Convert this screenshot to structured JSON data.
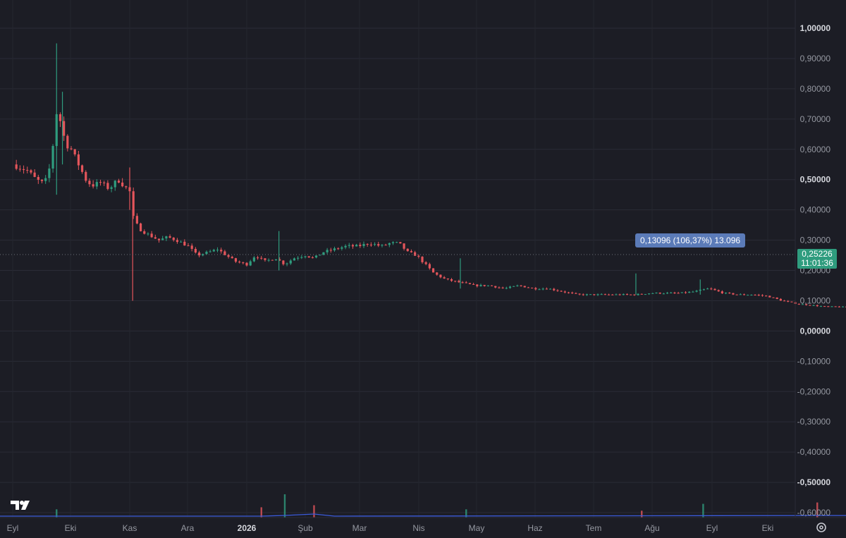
{
  "chart_data": {
    "type": "candlestick",
    "y_axis": {
      "ticks": [
        "1,00000",
        "0,90000",
        "0,80000",
        "0,70000",
        "0,60000",
        "0,50000",
        "0,40000",
        "0,30000",
        "0,20000",
        "0,10000",
        "0,00000",
        "-0,10000",
        "-0,20000",
        "-0,30000",
        "-0,40000",
        "-0,50000",
        "-0,60000"
      ],
      "bold_ticks": [
        "1,00000",
        "0,50000",
        "0,00000",
        "-0,50000"
      ],
      "range": [
        -0.6,
        1.0
      ]
    },
    "x_axis": {
      "ticks": [
        "Eyl",
        "Eki",
        "Kas",
        "Ara",
        "2026",
        "Şub",
        "Mar",
        "Nis",
        "May",
        "Haz",
        "Tem",
        "Ağu",
        "Eyl",
        "Eki"
      ],
      "bold_ticks": [
        "2026"
      ]
    },
    "last_price": "0,25226",
    "countdown": "11:01:36",
    "measurement": "0,13096 (106,37%) 13.096",
    "price_path": [
      [
        0.0,
        0.55
      ],
      [
        0.5,
        0.53
      ],
      [
        0.8,
        0.5
      ],
      [
        1.0,
        0.49
      ],
      [
        1.1,
        0.49
      ],
      [
        1.3,
        0.55
      ],
      [
        1.5,
        0.72
      ],
      [
        1.65,
        0.69
      ],
      [
        1.8,
        0.62
      ],
      [
        2.0,
        0.6
      ],
      [
        2.2,
        0.56
      ],
      [
        2.5,
        0.5
      ],
      [
        2.7,
        0.48
      ],
      [
        3.0,
        0.49
      ],
      [
        3.3,
        0.47
      ],
      [
        3.6,
        0.5
      ],
      [
        3.8,
        0.48
      ],
      [
        4.0,
        0.46
      ],
      [
        4.1,
        0.38
      ],
      [
        4.3,
        0.34
      ],
      [
        4.6,
        0.32
      ],
      [
        5.0,
        0.3
      ],
      [
        5.3,
        0.31
      ],
      [
        5.6,
        0.3
      ],
      [
        6.0,
        0.28
      ],
      [
        6.3,
        0.25
      ],
      [
        6.7,
        0.26
      ],
      [
        7.0,
        0.27
      ],
      [
        7.3,
        0.25
      ],
      [
        7.6,
        0.23
      ],
      [
        8.0,
        0.22
      ],
      [
        8.3,
        0.25
      ],
      [
        8.6,
        0.23
      ],
      [
        9.0,
        0.24
      ],
      [
        9.3,
        0.22
      ],
      [
        9.6,
        0.24
      ],
      [
        10.0,
        0.25
      ],
      [
        10.3,
        0.24
      ],
      [
        10.6,
        0.26
      ],
      [
        11.0,
        0.27
      ],
      [
        11.4,
        0.28
      ],
      [
        11.8,
        0.28
      ],
      [
        12.2,
        0.29
      ],
      [
        12.6,
        0.28
      ],
      [
        12.9,
        0.29
      ],
      [
        13.2,
        0.29
      ],
      [
        13.5,
        0.26
      ],
      [
        13.8,
        0.25
      ],
      [
        14.1,
        0.22
      ],
      [
        14.4,
        0.19
      ],
      [
        14.8,
        0.17
      ],
      [
        15.3,
        0.16
      ],
      [
        15.8,
        0.15
      ],
      [
        16.3,
        0.15
      ],
      [
        16.8,
        0.14
      ],
      [
        17.3,
        0.15
      ],
      [
        17.8,
        0.14
      ],
      [
        18.3,
        0.14
      ],
      [
        18.8,
        0.13
      ],
      [
        19.3,
        0.12
      ],
      [
        19.8,
        0.12
      ],
      [
        20.3,
        0.12
      ],
      [
        20.8,
        0.12
      ],
      [
        21.3,
        0.12
      ],
      [
        21.8,
        0.125
      ],
      [
        22.3,
        0.125
      ],
      [
        22.8,
        0.125
      ],
      [
        23.3,
        0.13
      ],
      [
        23.8,
        0.14
      ],
      [
        24.3,
        0.125
      ],
      [
        24.8,
        0.12
      ],
      [
        25.3,
        0.12
      ],
      [
        25.8,
        0.115
      ],
      [
        26.3,
        0.1
      ],
      [
        26.8,
        0.09
      ],
      [
        27.3,
        0.085
      ],
      [
        27.8,
        0.08
      ],
      [
        28.3,
        0.08
      ],
      [
        28.8,
        0.075
      ],
      [
        29.3,
        0.075
      ],
      [
        29.8,
        0.07
      ],
      [
        30.2,
        0.07
      ],
      [
        30.5,
        0.11
      ],
      [
        30.8,
        0.1
      ],
      [
        31.1,
        0.08
      ],
      [
        31.5,
        0.06
      ],
      [
        31.8,
        0.08
      ],
      [
        32.1,
        0.14
      ],
      [
        32.3,
        0.12
      ],
      [
        32.5,
        0.11
      ],
      [
        32.7,
        0.12
      ],
      [
        32.9,
        0.25226
      ]
    ],
    "spikes": [
      [
        1.5,
        0.45,
        0.95
      ],
      [
        1.7,
        0.55,
        0.79
      ],
      [
        4.0,
        0.4,
        0.54
      ],
      [
        4.1,
        0.1,
        0.4
      ],
      [
        9.1,
        0.2,
        0.33
      ],
      [
        15.3,
        0.14,
        0.24
      ],
      [
        21.3,
        0.12,
        0.19
      ],
      [
        23.5,
        0.12,
        0.17
      ],
      [
        30.3,
        0.06,
        0.15
      ],
      [
        32.0,
        0.09,
        0.15
      ]
    ],
    "volume": [
      [
        1.5,
        0.012
      ],
      [
        8.5,
        0.015
      ],
      [
        9.3,
        0.034
      ],
      [
        10.3,
        0.018
      ],
      [
        15.5,
        0.012
      ],
      [
        21.5,
        0.01
      ],
      [
        23.6,
        0.02
      ],
      [
        27.5,
        0.022
      ],
      [
        30.4,
        0.233
      ],
      [
        30.6,
        0.043
      ],
      [
        30.8,
        0.04
      ],
      [
        31.0,
        0.03
      ],
      [
        31.4,
        0.015
      ],
      [
        31.8,
        0.09
      ],
      [
        31.9,
        0.21
      ],
      [
        32.1,
        0.085
      ],
      [
        32.4,
        0.05
      ],
      [
        32.8,
        0.09
      ]
    ]
  },
  "icons": {
    "logo": "tradingview-logo-icon",
    "settings": "settings-gear-icon",
    "measure_arrow": "up-arrow-icon"
  },
  "colors": {
    "up": "#2f9c7e",
    "down": "#e4555b",
    "background": "#1c1d25",
    "volume_ma": "#3b5bdb",
    "price_tag": "#2f9c7e",
    "measure_label": "#5b7bb8"
  }
}
